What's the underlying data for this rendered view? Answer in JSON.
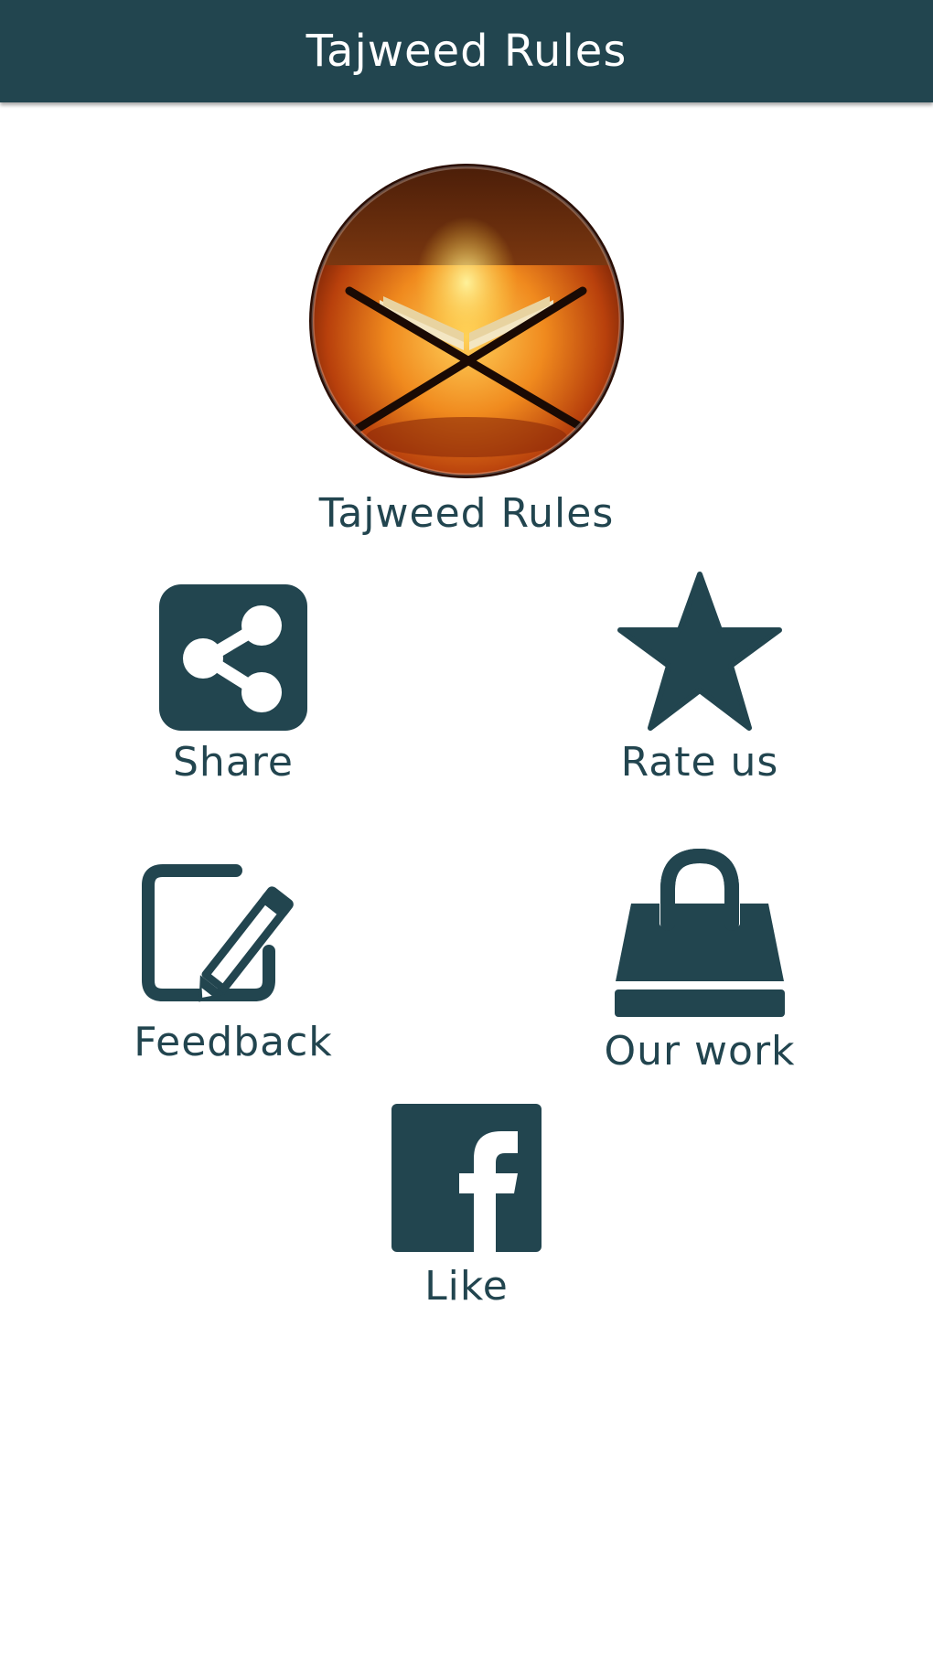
{
  "header": {
    "title": "Tajweed Rules"
  },
  "app": {
    "name": "Tajweed Rules",
    "logo_icon": "quran-stand-logo-icon"
  },
  "actions": {
    "share": {
      "label": "Share",
      "icon": "share-icon"
    },
    "rate": {
      "label": "Rate us",
      "icon": "star-icon"
    },
    "feedback": {
      "label": "Feedback",
      "icon": "edit-pencil-icon"
    },
    "our_work": {
      "label": "Our work",
      "icon": "shopping-bag-icon"
    },
    "like": {
      "label": "Like",
      "icon": "facebook-icon"
    }
  },
  "colors": {
    "primary": "#22454f",
    "background": "#ffffff"
  }
}
